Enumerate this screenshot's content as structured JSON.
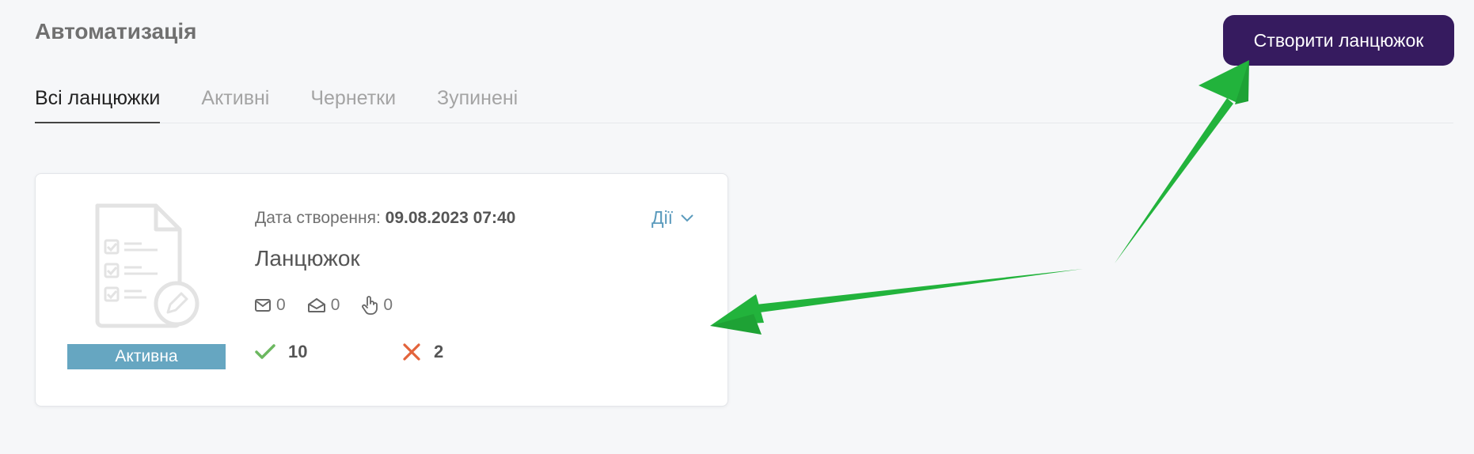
{
  "header": {
    "title": "Автоматизація",
    "create_button_label": "Створити ланцюжок"
  },
  "tabs": [
    {
      "label": "Всі ланцюжки",
      "active": true
    },
    {
      "label": "Активні",
      "active": false
    },
    {
      "label": "Чернетки",
      "active": false
    },
    {
      "label": "Зупинені",
      "active": false
    }
  ],
  "card": {
    "created_label": "Дата створення:",
    "created_value": "09.08.2023 07:40",
    "actions_label": "Дії",
    "name": "Ланцюжок",
    "status": "Активна",
    "stats": {
      "sent": "0",
      "opened": "0",
      "clicked": "0"
    },
    "success_count": "10",
    "fail_count": "2"
  },
  "colors": {
    "primary": "#361b5f",
    "badge": "#66a6c1",
    "link": "#5b9bbd",
    "success": "#6cb860",
    "error": "#e3633b",
    "annotation_arrow": "#22b33c"
  }
}
